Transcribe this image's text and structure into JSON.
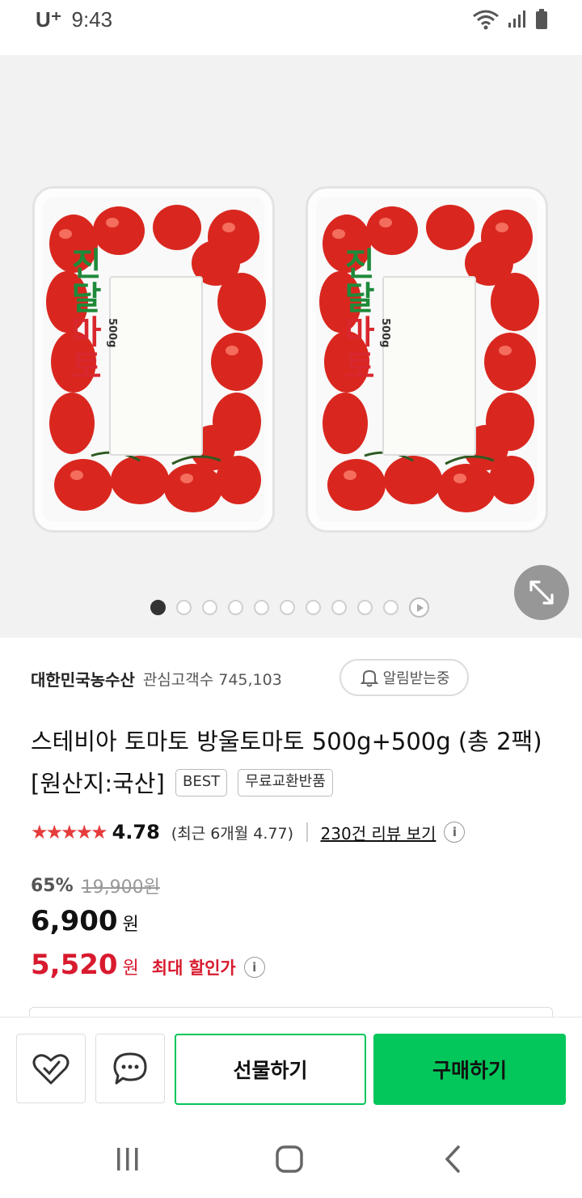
{
  "status_bar": {
    "carrier": "U⁺",
    "time": "9:43"
  },
  "gallery": {
    "package_label_green": "진달",
    "package_label_red": "마토",
    "package_weight": "500g",
    "slide_count": 10,
    "active_slide": 1
  },
  "store": {
    "name": "대한민국농수산",
    "fans": "관심고객수 745,103",
    "notify_label": "알림받는중"
  },
  "product": {
    "title": "스테비아 토마토 방울토마토 500g+500g (총 2팩) [원산지:국산]",
    "tags": [
      "BEST",
      "무료교환반품"
    ]
  },
  "rating": {
    "stars": "★★★★★",
    "score": "4.78",
    "recent": "(최근 6개월 4.77)",
    "review_link": "230건 리뷰 보기"
  },
  "price": {
    "discount_rate": "65%",
    "original": "19,900원",
    "sale": "6,900",
    "sale_unit": "원",
    "max_discount": "5,520",
    "max_discount_unit": "원",
    "max_discount_label": "최대 할인가"
  },
  "actions": {
    "gift_label": "선물하기",
    "buy_label": "구매하기"
  },
  "colors": {
    "accent_green": "#03c75a",
    "price_red": "#d81a2e",
    "star_red": "#e63c3c"
  }
}
